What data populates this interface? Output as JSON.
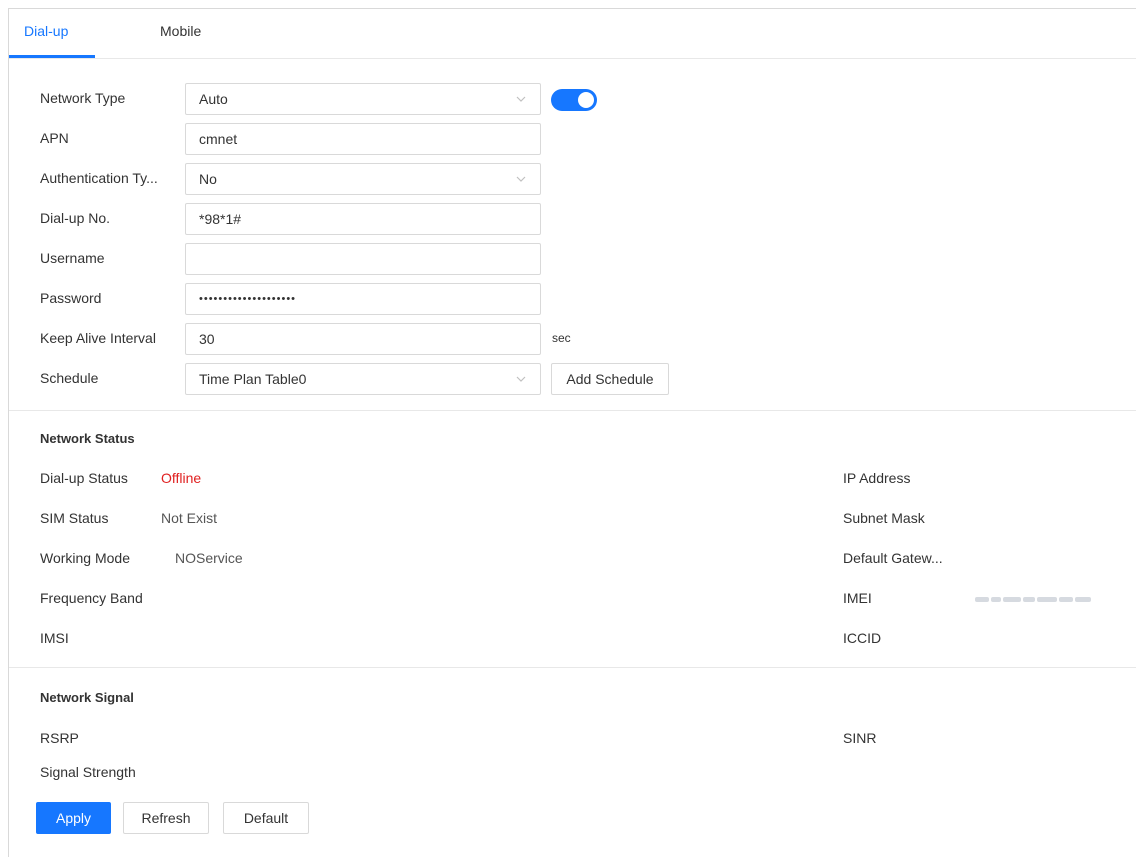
{
  "tabs": [
    {
      "label": "Dial-up",
      "active": true
    },
    {
      "label": "Mobile",
      "active": false
    }
  ],
  "form": {
    "network_type": {
      "label": "Network Type",
      "value": "Auto",
      "enabled": true
    },
    "apn": {
      "label": "APN",
      "value": "cmnet"
    },
    "auth_type": {
      "label": "Authentication Ty...",
      "value": "No"
    },
    "dialup_no": {
      "label": "Dial-up No.",
      "value": "*98*1#"
    },
    "username": {
      "label": "Username",
      "value": ""
    },
    "password": {
      "label": "Password",
      "value": "••••••••••••••••••••"
    },
    "keep_alive": {
      "label": "Keep Alive Interval",
      "value": "30",
      "unit": "sec"
    },
    "schedule": {
      "label": "Schedule",
      "value": "Time Plan Table0",
      "add_button": "Add Schedule"
    }
  },
  "network_status": {
    "title": "Network Status",
    "left": [
      {
        "label": "Dial-up Status",
        "value": "Offline"
      },
      {
        "label": "SIM Status",
        "value": "Not Exist"
      },
      {
        "label": "Working Mode",
        "value": "NOService"
      },
      {
        "label": "Frequency Band",
        "value": ""
      },
      {
        "label": "IMSI",
        "value": ""
      }
    ],
    "right": [
      {
        "label": "IP Address",
        "value": ""
      },
      {
        "label": "Subnet Mask",
        "value": ""
      },
      {
        "label": "Default Gatew...",
        "value": ""
      },
      {
        "label": "IMEI",
        "value": ""
      },
      {
        "label": "ICCID",
        "value": ""
      }
    ]
  },
  "network_signal": {
    "title": "Network Signal",
    "left": [
      {
        "label": "RSRP",
        "value": ""
      },
      {
        "label": "Signal Strength",
        "value": ""
      }
    ],
    "right": [
      {
        "label": "SINR",
        "value": ""
      }
    ]
  },
  "actions": {
    "apply": "Apply",
    "refresh": "Refresh",
    "default": "Default"
  },
  "colors": {
    "accent": "#1677ff",
    "offline": "#e02020",
    "border": "#d9d9d9"
  }
}
